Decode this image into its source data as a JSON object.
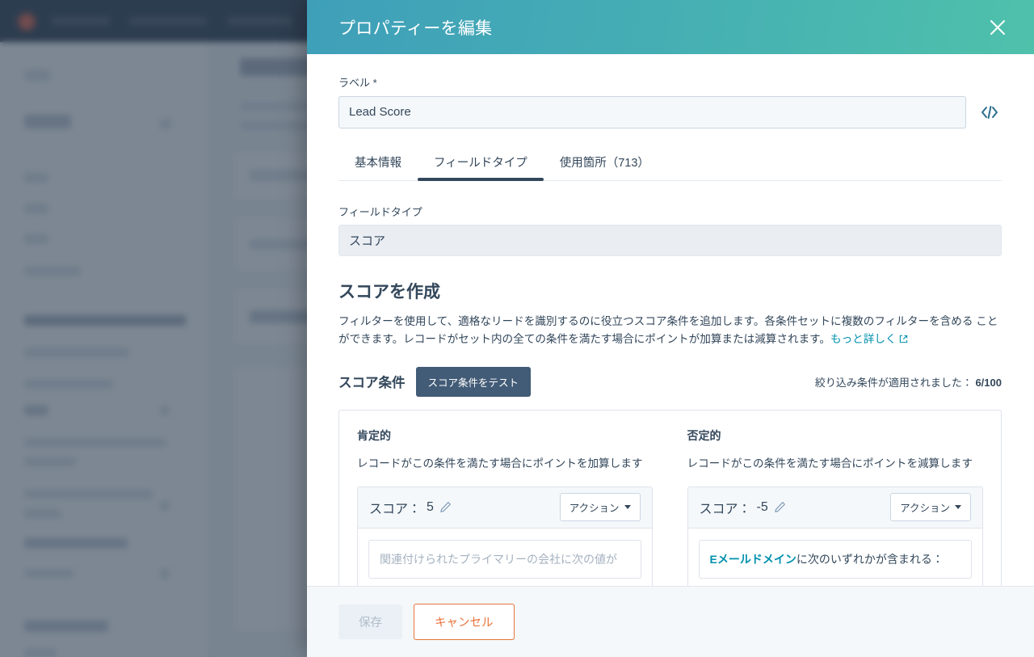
{
  "modal": {
    "title": "プロパティーを編集",
    "close_icon": "close-icon",
    "label_field": {
      "label": "ラベル *",
      "value": "Lead Score",
      "placeholder": "ラベル",
      "code_icon": "</>"
    },
    "tabs": [
      {
        "label": "基本情報",
        "active": false
      },
      {
        "label": "フィールドタイプ",
        "active": true
      },
      {
        "label": "使用箇所（713）",
        "active": false
      }
    ],
    "field_type": {
      "label": "フィールドタイプ",
      "value": "スコア"
    },
    "score_section": {
      "heading": "スコアを作成",
      "description_line1": "フィルターを使用して、適格なリードを識別するのに役立つスコア条件を追加します。各条件セットに複数のフィルターを含める",
      "description_line2": "ことができます。レコードがセット内の全ての条件を満たす場合にポイントが加算または減算されます。",
      "more_link": "もっと詳しく",
      "conditions_title": "スコア条件",
      "test_button": "スコア条件をテスト",
      "filters_applied_label": "絞り込み条件が適用されました：",
      "filters_applied_value": "6/100",
      "columns": [
        {
          "title": "肯定的",
          "subtitle": "レコードがこの条件を満たす場合にポイントを加算します",
          "score_prefix": "スコア：",
          "score_value": "5",
          "edit_icon": "pencil-icon",
          "action_button": "アクション",
          "filter_text": "関連付けられたプライマリーの会社に次の値が",
          "filter_property": "",
          "filter_is_placeholder": true
        },
        {
          "title": "否定的",
          "subtitle": "レコードがこの条件を満たす場合にポイントを減算します",
          "score_prefix": "スコア：",
          "score_value": "-5",
          "edit_icon": "pencil-icon",
          "action_button": "アクション",
          "filter_text": "に次のいずれかが含まれる：",
          "filter_property": "Eメールドメイン",
          "filter_is_placeholder": false
        }
      ]
    },
    "footer": {
      "save_label": "保存",
      "cancel_label": "キャンセル"
    }
  },
  "colors": {
    "header_gradient_start": "#3f9fb9",
    "header_gradient_end": "#4fc1ab",
    "accent_link": "#0091ae",
    "primary_dark": "#33475b",
    "test_button_bg": "#425b76",
    "cancel_orange": "#e8743b",
    "backdrop_nav": "#2e3e4f"
  }
}
